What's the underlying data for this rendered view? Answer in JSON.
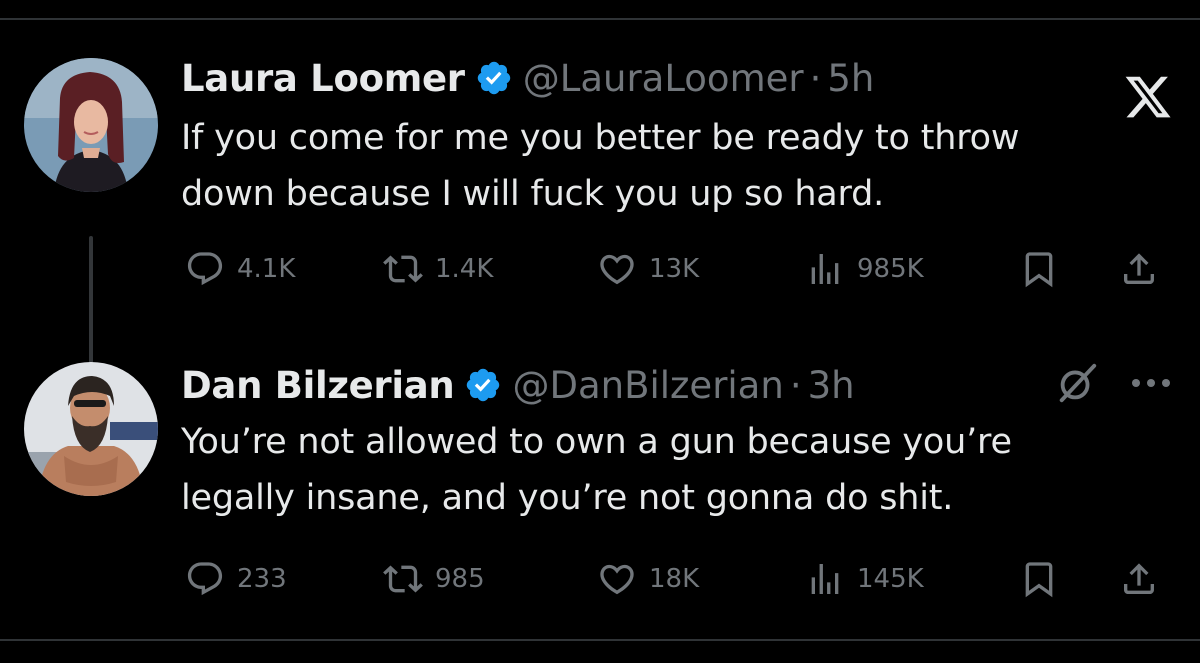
{
  "tweets": [
    {
      "author_name": "Laura Loomer",
      "handle": "@LauraLoomer",
      "separator": "·",
      "time": "5h",
      "text_lines": [
        "If you come for me you better be ready to throw",
        "down because I will fuck you up so hard."
      ],
      "replies": "4.1K",
      "reposts": "1.4K",
      "likes": "13K",
      "views": "985K"
    },
    {
      "author_name": "Dan Bilzerian",
      "handle": "@DanBilzerian",
      "separator": "·",
      "time": "3h",
      "text_lines": [
        "You’re not allowed to own a gun because you’re",
        "legally insane, and you’re not gonna do shit."
      ],
      "replies": "233",
      "reposts": "985",
      "likes": "18K",
      "views": "145K"
    }
  ],
  "icons": {
    "verified": "verified-badge-icon",
    "platform_logo": "x-logo-icon",
    "grok": "grok-icon",
    "more": "more-icon",
    "reply": "reply-icon",
    "repost": "repost-icon",
    "like": "like-icon",
    "views": "views-icon",
    "bookmark": "bookmark-icon",
    "share": "share-icon"
  },
  "colors": {
    "background": "#000000",
    "text_primary": "#e7e9ea",
    "text_secondary": "#71767b",
    "verified_blue": "#1d9bf0",
    "divider": "#2f3336"
  }
}
